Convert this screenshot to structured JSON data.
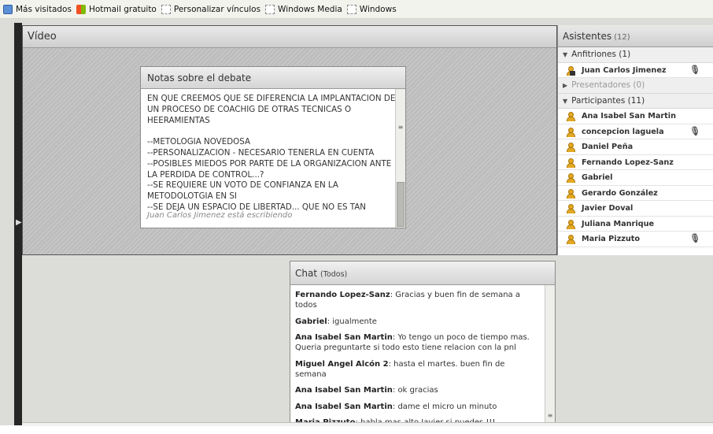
{
  "bookmarks": [
    {
      "label": "Más visitados",
      "icon": "page-icon"
    },
    {
      "label": "Hotmail gratuito",
      "icon": "windows-icon"
    },
    {
      "label": "Personalizar vínculos",
      "icon": "empty-bookmark-icon"
    },
    {
      "label": "Windows Media",
      "icon": "empty-bookmark-icon"
    },
    {
      "label": "Windows",
      "icon": "empty-bookmark-icon"
    }
  ],
  "video": {
    "title": "Vídeo"
  },
  "notes": {
    "title": "Notas sobre el debate",
    "lines": [
      "EN QUE CREEMOS QUE SE DIFERENCIA LA IMPLANTACION DE UN PROCESO DE COACHIG DE OTRAS TECNICAS O HEERAMIENTAS",
      "",
      "--METOLOGIA NOVEDOSA",
      "--PERSONALIZACION - NECESARIO TENERLA EN CUENTA",
      "--POSIBLES MIEDOS POR PARTE DE LA ORGANIZACION ANTE LA PERDIDA DE CONTROL...?",
      "--SE REQUIERE UN VOTO DE CONFIANZA EN LA METODOLOTGIA EN SI",
      "--SE DEJA UN ESPACIO DE LIBERTAD... QUE NO ES TAN"
    ],
    "typing_status": "Juan Carlos Jimenez está escribiendo"
  },
  "attendees": {
    "title": "Asistentes",
    "count": "(12)",
    "groups": [
      {
        "label": "Anfitriones (1)",
        "expanded": true,
        "members": [
          {
            "name": "Juan Carlos Jimenez",
            "mic": true,
            "host": true
          }
        ]
      },
      {
        "label": "Presentadores (0)",
        "expanded": false,
        "members": []
      },
      {
        "label": "Participantes (11)",
        "expanded": true,
        "members": [
          {
            "name": "Ana Isabel San Martin",
            "mic": false
          },
          {
            "name": "concepcion laguela",
            "mic": true
          },
          {
            "name": "Daniel Peña",
            "mic": false
          },
          {
            "name": "Fernando Lopez-Sanz",
            "mic": false
          },
          {
            "name": "Gabriel",
            "mic": false
          },
          {
            "name": "Gerardo González",
            "mic": false
          },
          {
            "name": "Javier Doval",
            "mic": false
          },
          {
            "name": "Juliana Manrique",
            "mic": false
          },
          {
            "name": "Maria Pizzuto",
            "mic": true
          }
        ]
      }
    ]
  },
  "chat": {
    "title": "Chat",
    "scope": "(Todos)",
    "messages": [
      {
        "sender": "Fernando Lopez-Sanz",
        "text": "Gracias y buen fin de semana a todos"
      },
      {
        "sender": "Gabriel",
        "text": "igualmente"
      },
      {
        "sender": "Ana Isabel San Martin",
        "text": "Yo tengo un poco de tiempo mas. Queria preguntarte si todo esto tiene relacion con la pnl"
      },
      {
        "sender": "Miguel Angel Alcón 2",
        "text": "hasta el martes. buen fin de semana"
      },
      {
        "sender": "Ana Isabel San Martin",
        "text": "ok gracias"
      },
      {
        "sender": "Ana Isabel San Martin",
        "text": "dame el micro un minuto"
      },
      {
        "sender": "Maria Pizzuto",
        "text": "habla mas alto Javier si puedes !!!"
      }
    ]
  }
}
